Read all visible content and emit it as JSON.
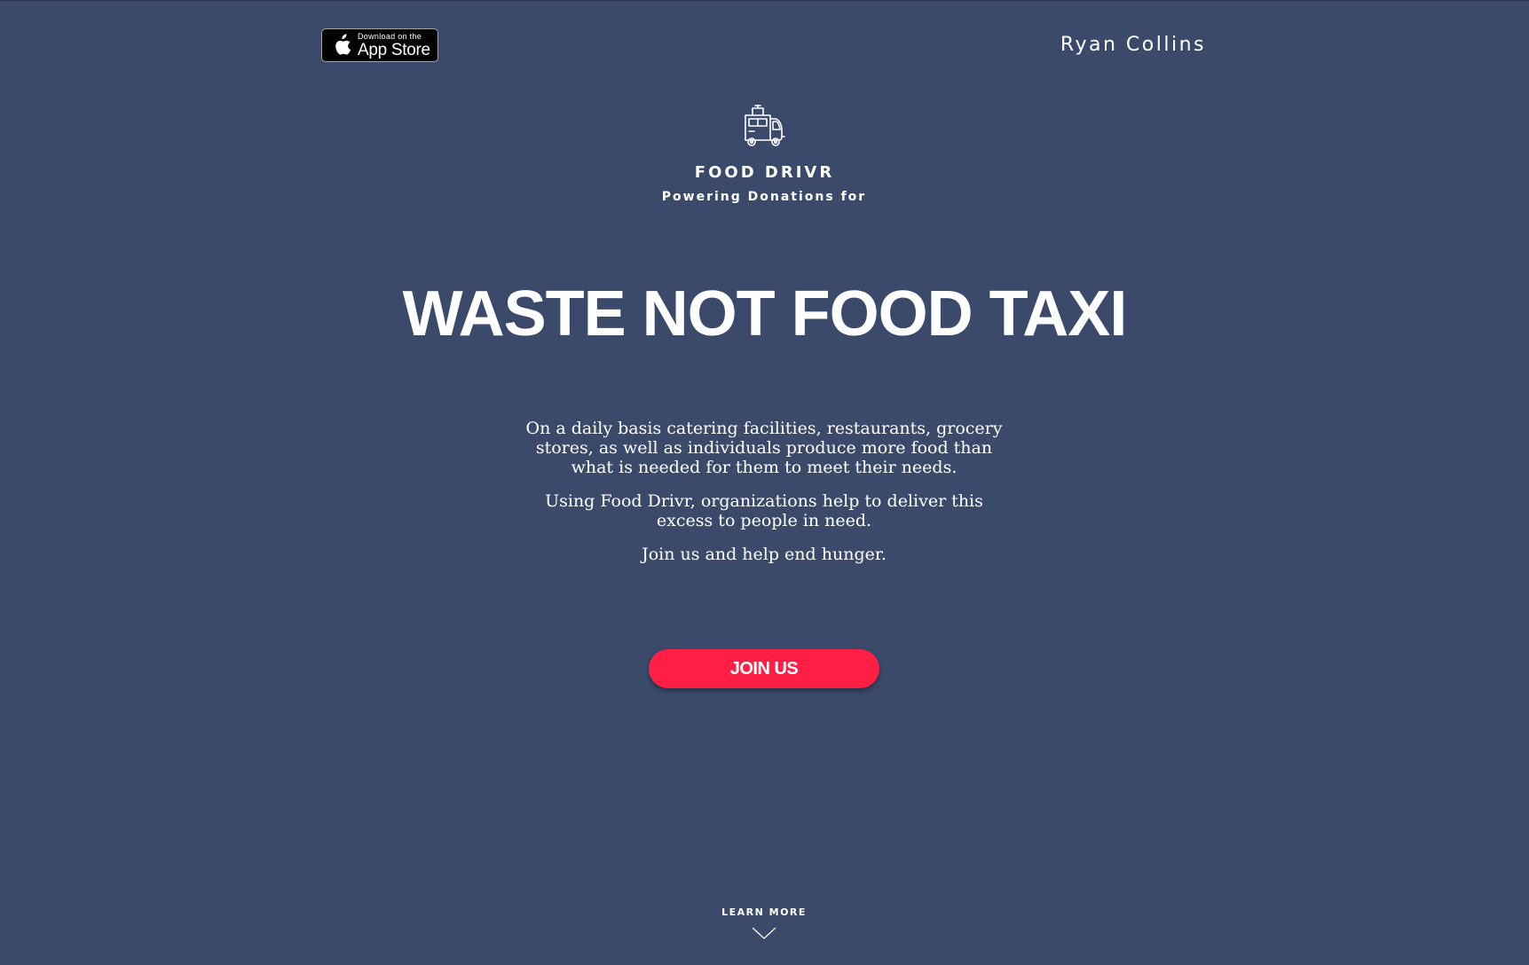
{
  "header": {
    "app_store_badge": {
      "small_text": "Download on the",
      "large_text": "App Store",
      "icon": "apple-icon"
    },
    "user_name": "Ryan Collins"
  },
  "brand": {
    "logo_icon": "food-truck-icon",
    "name": "FOOD DRIVR",
    "tagline": "Powering Donations for"
  },
  "hero": {
    "title": "WASTE NOT FOOD TAXI",
    "paragraphs": [
      "On a daily basis catering facilities, restaurants, grocery stores, as well as individuals produce more food than what is needed for them to meet their needs.",
      "Using Food Drivr, organizations help to deliver this excess to people in need.",
      "Join us and help end hunger."
    ],
    "cta_label": "JOIN US"
  },
  "footer": {
    "learn_more_label": "LEARN MORE",
    "chevron_icon": "chevron-down-icon"
  },
  "colors": {
    "background": "#3b4a6b",
    "accent": "#ff1f44",
    "text": "#ffffff"
  }
}
